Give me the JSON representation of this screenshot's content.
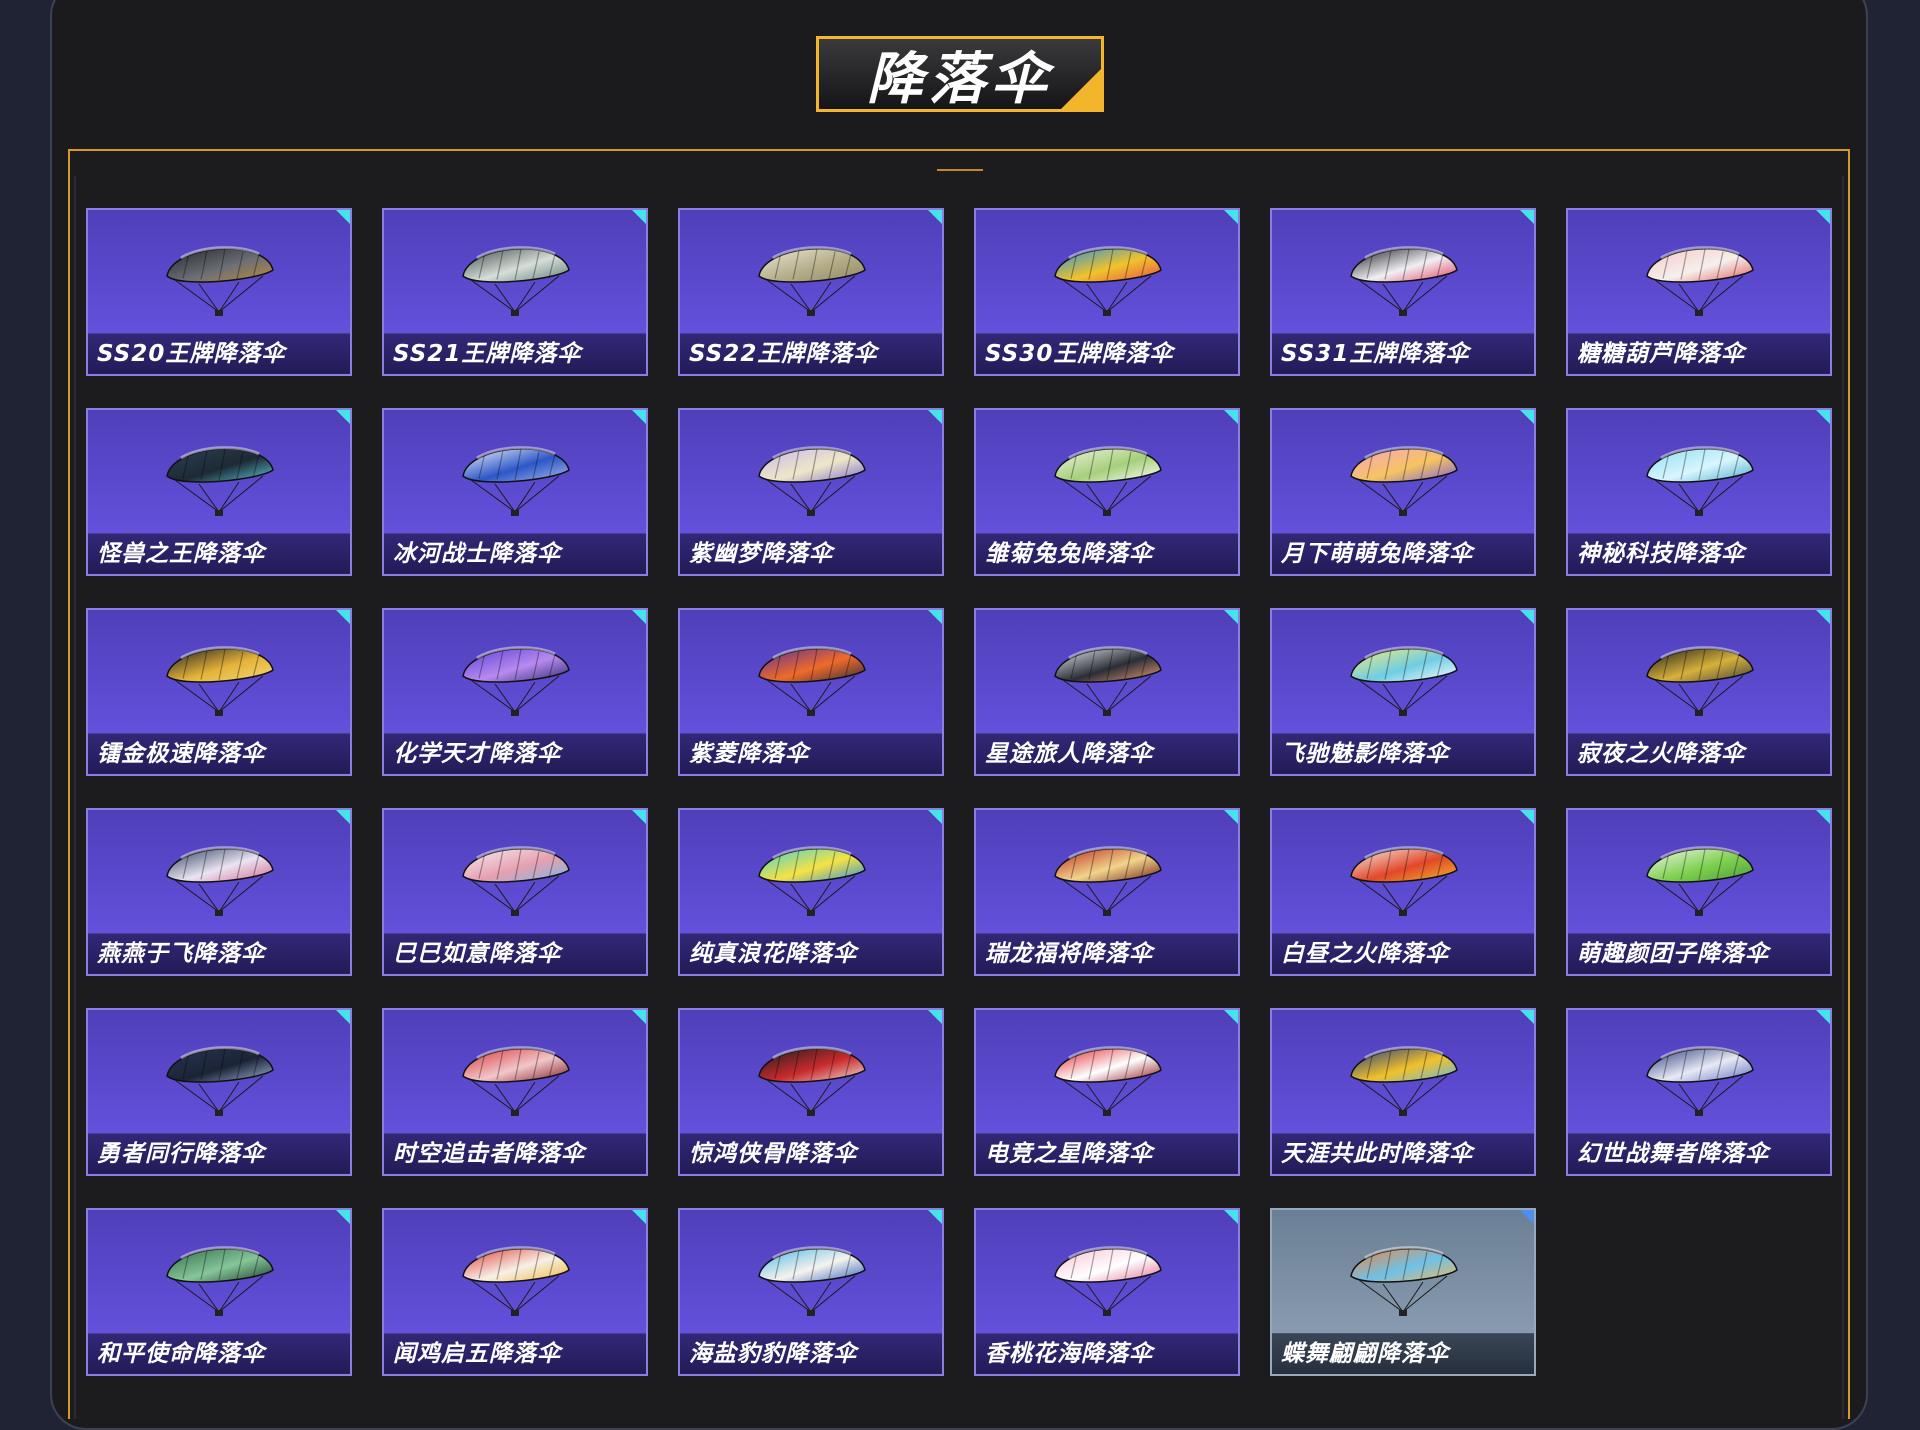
{
  "page_title": "降落伞",
  "items": [
    {
      "label": "SS20王牌降落伞",
      "icon": "parachute-icon",
      "colors": [
        "#222428",
        "#6b6f75",
        "#c08a3e"
      ]
    },
    {
      "label": "SS21王牌降落伞",
      "icon": "parachute-icon",
      "colors": [
        "#3d4a4a",
        "#d7ddd8",
        "#5c7c74"
      ]
    },
    {
      "label": "SS22王牌降落伞",
      "icon": "parachute-icon",
      "colors": [
        "#e9e6d8",
        "#b5ad88",
        "#8f8663"
      ]
    },
    {
      "label": "SS30王牌降落伞",
      "icon": "parachute-icon",
      "colors": [
        "#1e8fe3",
        "#f2c32a",
        "#e64a4a"
      ]
    },
    {
      "label": "SS31王牌降落伞",
      "icon": "parachute-icon",
      "colors": [
        "#1b1b22",
        "#f0f0f4",
        "#e23a5a"
      ]
    },
    {
      "label": "糖糖葫芦降落伞",
      "icon": "parachute-icon",
      "colors": [
        "#f7c6c6",
        "#f5f0ec",
        "#e05a5a"
      ]
    },
    {
      "label": "怪兽之王降落伞",
      "icon": "parachute-icon",
      "colors": [
        "#2c3f52",
        "#1d2a35",
        "#5ec8d8"
      ]
    },
    {
      "label": "冰河战士降落伞",
      "icon": "parachute-icon",
      "colors": [
        "#f4f6fa",
        "#2d57c8",
        "#a9bde8"
      ]
    },
    {
      "label": "紫幽梦降落伞",
      "icon": "parachute-icon",
      "colors": [
        "#c9b7ef",
        "#eee7c7",
        "#7d6ad0"
      ]
    },
    {
      "label": "雏菊兔兔降落伞",
      "icon": "parachute-icon",
      "colors": [
        "#f0f4e6",
        "#a6cf7a",
        "#ffffff"
      ]
    },
    {
      "label": "月下萌萌兔降落伞",
      "icon": "parachute-icon",
      "colors": [
        "#f4a4c8",
        "#f7c460",
        "#7b5fd8"
      ]
    },
    {
      "label": "神秘科技降落伞",
      "icon": "parachute-icon",
      "colors": [
        "#8fdcef",
        "#d8f6ff",
        "#4aaac8"
      ]
    },
    {
      "label": "镭金极速降落伞",
      "icon": "parachute-icon",
      "colors": [
        "#1c1c22",
        "#e4b33a",
        "#f6d777"
      ]
    },
    {
      "label": "化学天才降落伞",
      "icon": "parachute-icon",
      "colors": [
        "#5a3fd6",
        "#b88af0",
        "#2a2a6c"
      ]
    },
    {
      "label": "紫菱降落伞",
      "icon": "parachute-icon",
      "colors": [
        "#5a2f9a",
        "#f06a2a",
        "#2a2a3c"
      ]
    },
    {
      "label": "星途旅人降落伞",
      "icon": "parachute-icon",
      "colors": [
        "#e8ecf2",
        "#2b2e36",
        "#f2a07a"
      ]
    },
    {
      "label": "飞驰魅影降落伞",
      "icon": "parachute-icon",
      "colors": [
        "#f5ec7a",
        "#6fcde3",
        "#ffffff"
      ]
    },
    {
      "label": "寂夜之火降落伞",
      "icon": "parachute-icon",
      "colors": [
        "#1b1b1f",
        "#d7b13a",
        "#3c3c44"
      ]
    },
    {
      "label": "燕燕于飞降落伞",
      "icon": "parachute-icon",
      "colors": [
        "#2b3c5e",
        "#e9e4f2",
        "#d7688a"
      ]
    },
    {
      "label": "巳巳如意降落伞",
      "icon": "parachute-icon",
      "colors": [
        "#f6eef2",
        "#e6a0b0",
        "#7bb7e8"
      ]
    },
    {
      "label": "纯真浪花降落伞",
      "icon": "parachute-icon",
      "colors": [
        "#3fd2d7",
        "#f6e244",
        "#2a8fe0"
      ]
    },
    {
      "label": "瑞龙福将降落伞",
      "icon": "parachute-icon",
      "colors": [
        "#b9261f",
        "#f2d48a",
        "#6b1a18"
      ]
    },
    {
      "label": "白昼之火降落伞",
      "icon": "parachute-icon",
      "colors": [
        "#f4f1ec",
        "#e2482a",
        "#f3b82a"
      ]
    },
    {
      "label": "萌趣颜团子降落伞",
      "icon": "parachute-icon",
      "colors": [
        "#f4f6ee",
        "#7ed04f",
        "#4a9c3a"
      ]
    },
    {
      "label": "勇者同行降落伞",
      "icon": "parachute-icon",
      "colors": [
        "#283552",
        "#1b2336",
        "#9fb5d8"
      ]
    },
    {
      "label": "时空追击者降落伞",
      "icon": "parachute-icon",
      "colors": [
        "#d7333a",
        "#f2c7c9",
        "#7b1a22"
      ]
    },
    {
      "label": "惊鸿侠骨降落伞",
      "icon": "parachute-icon",
      "colors": [
        "#1b1b22",
        "#c92b2b",
        "#f1e3e3"
      ]
    },
    {
      "label": "电竞之星降落伞",
      "icon": "parachute-icon",
      "colors": [
        "#e0242c",
        "#ffffff",
        "#8f1118"
      ]
    },
    {
      "label": "天涯共此时降落伞",
      "icon": "parachute-icon",
      "colors": [
        "#1f3a8a",
        "#f2c12a",
        "#5fb8e6"
      ]
    },
    {
      "label": "幻世战舞者降落伞",
      "icon": "parachute-icon",
      "colors": [
        "#2a3b7a",
        "#e7e9f4",
        "#5d6fc0"
      ]
    },
    {
      "label": "和平使命降落伞",
      "icon": "parachute-icon",
      "colors": [
        "#2f6a4a",
        "#86c69a",
        "#1b3c2a"
      ]
    },
    {
      "label": "闻鸡启五降落伞",
      "icon": "parachute-icon",
      "colors": [
        "#e23a3a",
        "#f7f1e6",
        "#f0b23a"
      ]
    },
    {
      "label": "海盐豹豹降落伞",
      "icon": "parachute-icon",
      "colors": [
        "#46b6e6",
        "#f6f3ee",
        "#2d5fb8"
      ]
    },
    {
      "label": "香桃花海降落伞",
      "icon": "parachute-icon",
      "colors": [
        "#f7c0d2",
        "#ffffff",
        "#e46e94"
      ]
    },
    {
      "label": "蝶舞翩翩降落伞",
      "icon": "parachute-icon",
      "colors": [
        "#f2823a",
        "#6ec2e8",
        "#f5b85a"
      ]
    }
  ]
}
